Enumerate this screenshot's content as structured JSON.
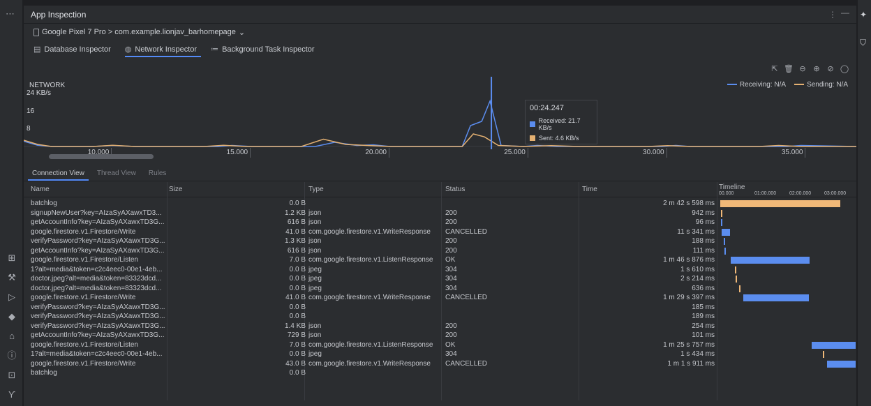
{
  "window": {
    "title": "App Inspection",
    "menu_glyph": "⋮",
    "minimize_glyph": "—"
  },
  "device": {
    "label": "Google Pixel 7 Pro > com.example.lionjav_barhomepage",
    "chevron": "⌄"
  },
  "inspector_tabs": [
    {
      "label": "Database Inspector",
      "icon": "database-icon",
      "glyph": "▤",
      "active": false
    },
    {
      "label": "Network Inspector",
      "icon": "globe-icon",
      "glyph": "◍",
      "active": true
    },
    {
      "label": "Background Task Inspector",
      "icon": "list-icon",
      "glyph": "≔",
      "active": false
    }
  ],
  "chart_toolbar": [
    {
      "icon": "detach-icon",
      "glyph": "⇱"
    },
    {
      "icon": "trash-icon",
      "glyph": "🗑"
    },
    {
      "icon": "zoom-out-icon",
      "glyph": "⊖"
    },
    {
      "icon": "zoom-in-icon",
      "glyph": "⊕"
    },
    {
      "icon": "reset-zoom-icon",
      "glyph": "⊘"
    },
    {
      "icon": "pause-icon",
      "glyph": "◯"
    }
  ],
  "chart_data": {
    "type": "line",
    "title": "NETWORK",
    "y_ticks": [
      "24 KB/s",
      "16",
      "8"
    ],
    "y_max": 24,
    "x_range": [
      7.0,
      37.0
    ],
    "x_ticks": [
      "10.000",
      "15.000",
      "20.000",
      "25.000",
      "30.000",
      "35.000"
    ],
    "series": [
      {
        "name": "Receiving: N/A",
        "color": "#5b8def",
        "points": [
          [
            7.0,
            2.5
          ],
          [
            7.5,
            0.6
          ],
          [
            8.0,
            0.0
          ],
          [
            9.5,
            0.0
          ],
          [
            10.2,
            0.5
          ],
          [
            11.0,
            0.0
          ],
          [
            14.0,
            0.0
          ],
          [
            14.5,
            0.5
          ],
          [
            15.2,
            0.0
          ],
          [
            17.5,
            0.0
          ],
          [
            18.2,
            2.0
          ],
          [
            19.0,
            0.5
          ],
          [
            19.6,
            0.8
          ],
          [
            20.2,
            0.0
          ],
          [
            22.0,
            0.0
          ],
          [
            22.8,
            0.0
          ],
          [
            23.1,
            10.0
          ],
          [
            23.5,
            12.0
          ],
          [
            23.8,
            21.7
          ],
          [
            24.2,
            0.5
          ],
          [
            25.0,
            0.0
          ],
          [
            25.5,
            0.5
          ],
          [
            26.2,
            0.0
          ],
          [
            30.0,
            0.0
          ],
          [
            30.5,
            0.5
          ],
          [
            31.0,
            0.0
          ],
          [
            34.5,
            0.0
          ],
          [
            35.0,
            0.5
          ],
          [
            37.0,
            0.0
          ]
        ]
      },
      {
        "name": "Sending: N/A",
        "color": "#e5b172",
        "points": [
          [
            7.0,
            3.0
          ],
          [
            7.5,
            1.0
          ],
          [
            8.0,
            0.0
          ],
          [
            9.5,
            0.0
          ],
          [
            10.2,
            0.6
          ],
          [
            11.0,
            0.0
          ],
          [
            13.5,
            0.0
          ],
          [
            14.2,
            0.6
          ],
          [
            15.0,
            0.0
          ],
          [
            17.0,
            0.0
          ],
          [
            17.8,
            3.5
          ],
          [
            18.6,
            1.0
          ],
          [
            19.5,
            0.4
          ],
          [
            20.2,
            0.0
          ],
          [
            22.0,
            0.0
          ],
          [
            22.8,
            0.0
          ],
          [
            23.2,
            6.0
          ],
          [
            23.6,
            4.6
          ],
          [
            24.1,
            0.5
          ],
          [
            25.0,
            0.0
          ],
          [
            26.0,
            0.4
          ],
          [
            27.0,
            0.0
          ],
          [
            29.5,
            0.0
          ],
          [
            30.2,
            0.4
          ],
          [
            31.0,
            0.0
          ],
          [
            33.5,
            0.0
          ],
          [
            34.2,
            0.5
          ],
          [
            35.0,
            0.0
          ],
          [
            37.0,
            0.0
          ]
        ]
      }
    ],
    "cursor_x": 23.85,
    "tooltip": {
      "time": "00:24.247",
      "received": "Received: 21.7 KB/s",
      "sent": "Sent: 4.6 KB/s"
    },
    "legend_position": "top-right",
    "grid": false
  },
  "sub_tabs": [
    {
      "label": "Connection View",
      "active": true
    },
    {
      "label": "Thread View",
      "active": false
    },
    {
      "label": "Rules",
      "active": false
    }
  ],
  "table": {
    "headers": {
      "name": "Name",
      "size": "Size",
      "type": "Type",
      "status": "Status",
      "time": "Time",
      "timeline": "Timeline"
    },
    "timeline_ticks": [
      "00.000",
      "01:00.000",
      "02:00.000",
      "03:00.000"
    ],
    "timeline_max_seconds": 180,
    "rows": [
      {
        "name": "batchlog",
        "size": "0.0 B",
        "type": "",
        "status": "",
        "time": "2 m 42 s 598 ms",
        "start": 0,
        "duration": 162.6,
        "color": "#f0b878"
      },
      {
        "name": "signupNewUser?key=AIzaSyAXawxTD3...",
        "size": "1.2 KB",
        "type": "json",
        "status": "200",
        "time": "942 ms",
        "start": 0.5,
        "duration": 0.94,
        "color": "#f0b878"
      },
      {
        "name": "getAccountInfo?key=AIzaSyAXawxTD3G...",
        "size": "616 B",
        "type": "json",
        "status": "200",
        "time": "96 ms",
        "start": 1.0,
        "duration": 0.1,
        "color": "#5b8def"
      },
      {
        "name": "google.firestore.v1.Firestore/Write",
        "size": "41.0 B",
        "type": "com.google.firestore.v1.WriteResponse",
        "status": "CANCELLED",
        "time": "11 s 341 ms",
        "start": 2.0,
        "duration": 11.3,
        "color": "#5b8def"
      },
      {
        "name": "verifyPassword?key=AIzaSyAXawxTD3G...",
        "size": "1.3 KB",
        "type": "json",
        "status": "200",
        "time": "188 ms",
        "start": 5.0,
        "duration": 0.19,
        "color": "#5b8def"
      },
      {
        "name": "getAccountInfo?key=AIzaSyAXawxTD3G...",
        "size": "616 B",
        "type": "json",
        "status": "200",
        "time": "111 ms",
        "start": 5.5,
        "duration": 0.11,
        "color": "#5b8def"
      },
      {
        "name": "google.firestore.v1.Firestore/Listen",
        "size": "7.0 B",
        "type": "com.google.firestore.v1.ListenResponse",
        "status": "OK",
        "time": "1 m 46 s 876 ms",
        "start": 14.0,
        "duration": 106.9,
        "color": "#5b8def"
      },
      {
        "name": "1?alt=media&token=c2c4eec0-00e1-4eb...",
        "size": "0.0 B",
        "type": "jpeg",
        "status": "304",
        "time": "1 s 610 ms",
        "start": 20.0,
        "duration": 1.61,
        "color": "#f0b878"
      },
      {
        "name": "doctor.jpeg?alt=media&token=83323dcd...",
        "size": "0.0 B",
        "type": "jpeg",
        "status": "304",
        "time": "2 s 214 ms",
        "start": 20.5,
        "duration": 2.21,
        "color": "#f0b878"
      },
      {
        "name": "doctor.jpeg?alt=media&token=83323dcd...",
        "size": "0.0 B",
        "type": "jpeg",
        "status": "304",
        "time": "636 ms",
        "start": 26.0,
        "duration": 0.64,
        "color": "#f0b878"
      },
      {
        "name": "google.firestore.v1.Firestore/Write",
        "size": "41.0 B",
        "type": "com.google.firestore.v1.WriteResponse",
        "status": "CANCELLED",
        "time": "1 m 29 s 397 ms",
        "start": 31.0,
        "duration": 89.4,
        "color": "#5b8def"
      },
      {
        "name": "verifyPassword?key=AIzaSyAXawxTD3G...",
        "size": "0.0 B",
        "type": "",
        "status": "",
        "time": "185 ms",
        "start": 0,
        "duration": 0,
        "color": "#5b8def"
      },
      {
        "name": "verifyPassword?key=AIzaSyAXawxTD3G...",
        "size": "0.0 B",
        "type": "",
        "status": "",
        "time": "189 ms",
        "start": 0,
        "duration": 0,
        "color": "#5b8def"
      },
      {
        "name": "verifyPassword?key=AIzaSyAXawxTD3G...",
        "size": "1.4 KB",
        "type": "json",
        "status": "200",
        "time": "254 ms",
        "start": 0,
        "duration": 0,
        "color": "#5b8def"
      },
      {
        "name": "getAccountInfo?key=AIzaSyAXawxTD3G...",
        "size": "729 B",
        "type": "json",
        "status": "200",
        "time": "101 ms",
        "start": 0,
        "duration": 0,
        "color": "#5b8def"
      },
      {
        "name": "google.firestore.v1.Firestore/Listen",
        "size": "7.0 B",
        "type": "com.google.firestore.v1.ListenResponse",
        "status": "OK",
        "time": "1 m 25 s 757 ms",
        "start": 124.0,
        "duration": 85.8,
        "color": "#5b8def"
      },
      {
        "name": "1?alt=media&token=c2c4eec0-00e1-4eb...",
        "size": "0.0 B",
        "type": "jpeg",
        "status": "304",
        "time": "1 s 434 ms",
        "start": 139.0,
        "duration": 1.43,
        "color": "#f0b878"
      },
      {
        "name": "google.firestore.v1.Firestore/Write",
        "size": "43.0 B",
        "type": "com.google.firestore.v1.WriteResponse",
        "status": "CANCELLED",
        "time": "1 m 1 s 911 ms",
        "start": 145.0,
        "duration": 61.9,
        "color": "#5b8def"
      },
      {
        "name": "batchlog",
        "size": "0.0 B",
        "type": "",
        "status": "",
        "time": "",
        "start": 0,
        "duration": 0,
        "color": "#f0b878"
      }
    ]
  },
  "left_rail_icons": [
    {
      "icon": "more-icon",
      "glyph": "⋯"
    },
    {
      "icon": "app-inspection-icon",
      "glyph": "⊞"
    },
    {
      "icon": "build-icon",
      "glyph": "⚒"
    },
    {
      "icon": "run-icon",
      "glyph": "▷"
    },
    {
      "icon": "gem-icon",
      "glyph": "◆"
    },
    {
      "icon": "android-icon",
      "glyph": "⌂"
    },
    {
      "icon": "problems-icon",
      "glyph": "ⓘ"
    },
    {
      "icon": "terminal-icon",
      "glyph": "⊡"
    },
    {
      "icon": "git-icon",
      "glyph": "ϒ"
    }
  ],
  "right_rail_icons": [
    {
      "icon": "ai-assistant-icon",
      "glyph": "✦"
    },
    {
      "icon": "shield-icon",
      "glyph": "⛉"
    }
  ]
}
